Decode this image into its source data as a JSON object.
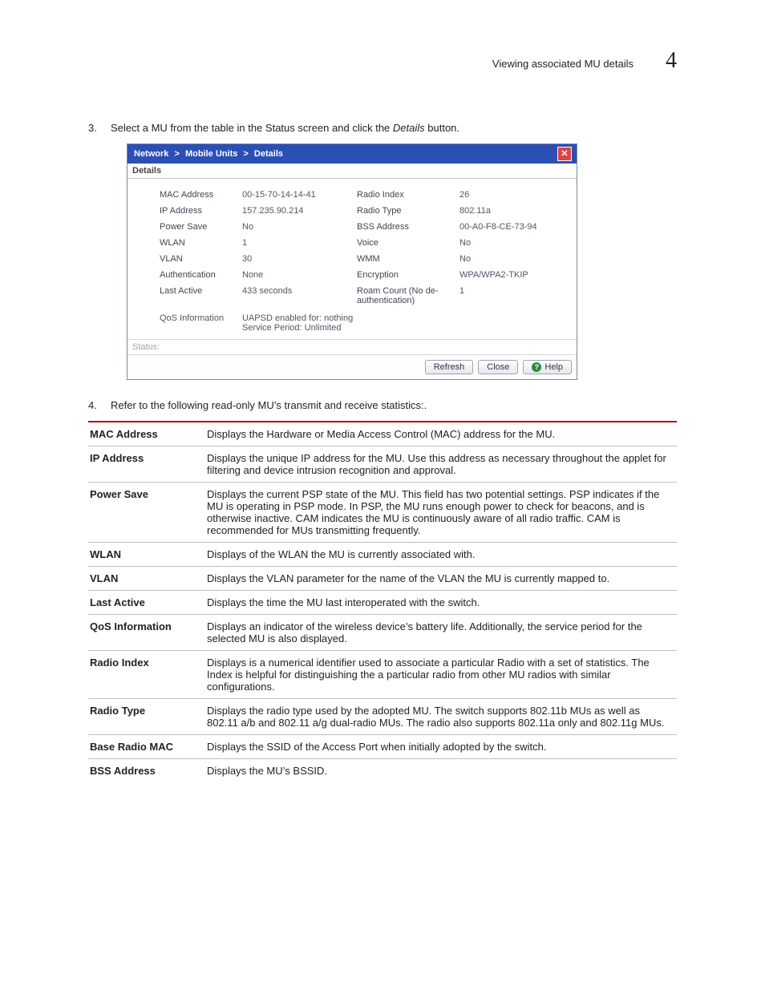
{
  "header": {
    "title": "Viewing associated MU details",
    "chapter": "4"
  },
  "steps": {
    "s3_num": "3.",
    "s3_a": "Select a MU from the table in the Status screen and click the ",
    "s3_b": "Details",
    "s3_c": " button.",
    "s4_num": "4.",
    "s4": "Refer to the following read-only MU’s transmit and receive statistics:."
  },
  "shot": {
    "crumb1": "Network",
    "sep": ">",
    "crumb2": "Mobile Units",
    "crumb3": "Details",
    "tab": "Details",
    "rows": {
      "mac_k": "MAC Address",
      "mac_v": "00-15-70-14-14-41",
      "ip_k": "IP Address",
      "ip_v": "157.235.90.214",
      "ps_k": "Power Save",
      "ps_v": "No",
      "wlan_k": "WLAN",
      "wlan_v": "1",
      "vlan_k": "VLAN",
      "vlan_v": "30",
      "auth_k": "Authentication",
      "auth_v": "None",
      "la_k": "Last Active",
      "la_v": "433 seconds",
      "ri_k": "Radio Index",
      "ri_v": "26",
      "rt_k": "Radio Type",
      "rt_v": "802.11a",
      "bss_k": "BSS Address",
      "bss_v": "00-A0-F8-CE-73-94",
      "voice_k": "Voice",
      "voice_v": "No",
      "wmm_k": "WMM",
      "wmm_v": "No",
      "enc_k": "Encryption",
      "enc_v": "WPA/WPA2-TKIP",
      "roam_k": "Roam Count (No de-authentication)",
      "roam_v": "1",
      "qos_k": "QoS Information",
      "qos_v1": "UAPSD enabled for: nothing",
      "qos_v2": "Service Period: Unlimited"
    },
    "status_label": "Status:",
    "btn_refresh": "Refresh",
    "btn_close": "Close",
    "btn_help": "Help",
    "help_q": "?"
  },
  "defs": [
    {
      "term": "MAC Address",
      "desc": "Displays the Hardware or Media Access Control (MAC) address for the MU."
    },
    {
      "term": "IP Address",
      "desc": "Displays the unique IP address for the MU. Use this address as necessary throughout the applet for filtering and device intrusion recognition and approval."
    },
    {
      "term": "Power Save",
      "desc": "Displays the current PSP state of the MU. This field has two potential settings. PSP indicates if the MU is operating in PSP mode. In PSP, the MU runs enough power to check for beacons, and is otherwise inactive. CAM indicates the MU is continuously aware of all radio traffic. CAM is recommended for MUs transmitting frequently."
    },
    {
      "term": "WLAN",
      "desc": "Displays of the WLAN the MU is currently associated with."
    },
    {
      "term": "VLAN",
      "desc": "Displays the VLAN parameter for the name of the VLAN the MU is currently mapped to."
    },
    {
      "term": "Last Active",
      "desc": "Displays the time the MU last interoperated with the switch."
    },
    {
      "term": "QoS Information",
      "desc": "Displays an indicator of the wireless device’s battery life. Additionally, the service period for the selected MU is also displayed."
    },
    {
      "term": "Radio Index",
      "desc": "Displays is a numerical identifier used to associate a particular Radio with a set of statistics. The Index is helpful for distinguishing the a particular radio from other MU radios with similar configurations."
    },
    {
      "term": "Radio Type",
      "desc": "Displays the radio type used by the adopted MU. The switch supports 802.11b MUs as well as 802.11 a/b and 802.11 a/g dual-radio MUs. The radio also supports 802.11a only and 802.11g MUs."
    },
    {
      "term": "Base Radio MAC",
      "desc": "Displays the SSID of the Access Port when initially adopted by the switch."
    },
    {
      "term": "BSS Address",
      "desc": "Displays the MU’s BSSID."
    }
  ]
}
